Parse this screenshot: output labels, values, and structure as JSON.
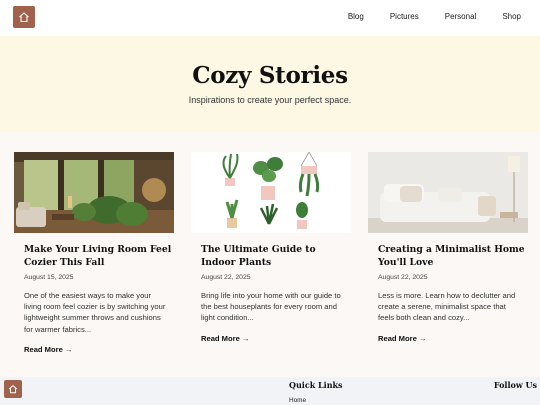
{
  "header": {
    "nav": [
      "Blog",
      "Pictures",
      "Personal",
      "Shop"
    ]
  },
  "hero": {
    "title": "Cozy Stories",
    "subtitle": "Inspirations to create your perfect space."
  },
  "cards": [
    {
      "title": "Make Your Living Room Feel Cozier This Fall",
      "date": "August 15, 2025",
      "excerpt": "One of the easiest ways to make your living room feel cozier is by switching your lightweight summer throws and cushions for warmer fabrics...",
      "read_more": "Read More →"
    },
    {
      "title": "The Ultimate Guide to Indoor Plants",
      "date": "August 22, 2025",
      "excerpt": "Bring life into your home with our guide to the best houseplants for every room and light condition...",
      "read_more": "Read More →"
    },
    {
      "title": "Creating a Minimalist Home You'll Love",
      "date": "August 22, 2025",
      "excerpt": "Less is more. Learn how to declutter and create a serene, minimalist space that feels both clean and cozy...",
      "read_more": "Read More →"
    }
  ],
  "footer": {
    "quick_links_title": "Quick Links",
    "home_link": "Home",
    "follow_title": "Follow Us"
  },
  "colors": {
    "brand": "#a0624c",
    "hero_bg": "#fdf8e4",
    "page_bg": "#fbf8f6",
    "footer_bg": "#f1f3f6"
  }
}
